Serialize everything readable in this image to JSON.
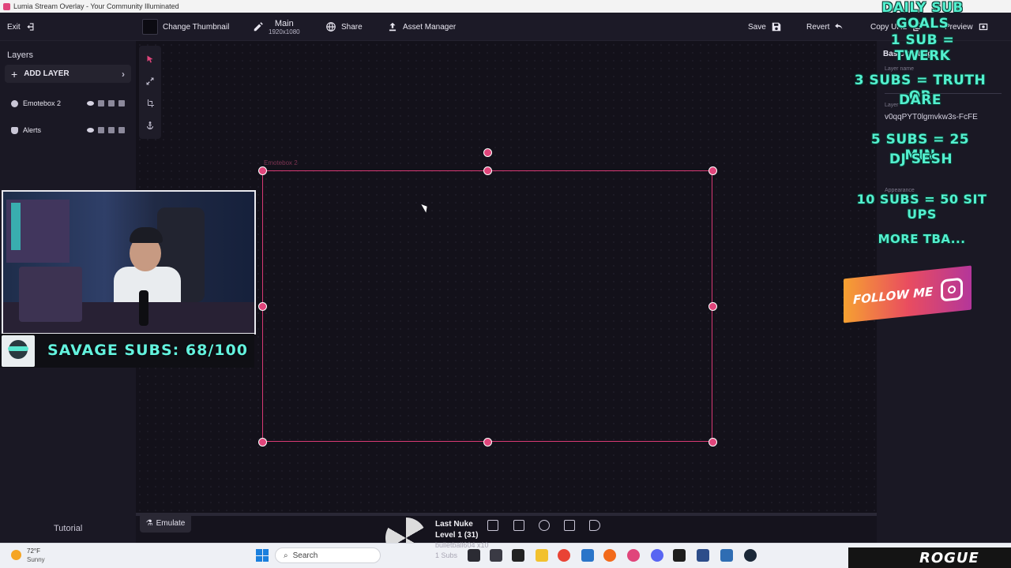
{
  "window": {
    "title": "Lumia Stream Overlay - Your Community Illuminated"
  },
  "toolbar": {
    "exit_label": "Exit",
    "change_thumbnail_label": "Change Thumbnail",
    "main_title": "Main",
    "main_resolution": "1920x1080",
    "share_label": "Share",
    "asset_manager_label": "Asset Manager",
    "save_label": "Save",
    "revert_label": "Revert",
    "copy_url_label": "Copy URL",
    "preview_label": "Preview"
  },
  "sidebar": {
    "layers_title": "Layers",
    "add_layer_label": "ADD LAYER",
    "layers": [
      {
        "name": "Emotebox 2",
        "icon": "emote-icon"
      },
      {
        "name": "Alerts",
        "icon": "bell-icon"
      }
    ],
    "tutorial_label": "Tutorial"
  },
  "canvas": {
    "selection_label": "Emotebox 2",
    "emulate_label": "Emulate"
  },
  "right_panel": {
    "basic_settings": "Basic settings",
    "layer_name_label": "Layer name",
    "layer_id_label": "Layer",
    "layer_id_value": "v0qqPYT0lgmvkw3s-FcFE",
    "appearance_label": "Appearance"
  },
  "overlay": {
    "subs_text": "SAVAGE SUBS: 68/100",
    "goals": [
      "DAILY SUB GOALS",
      "1 SUB = TWERK",
      "3 SUBS = TRUTH OR",
      "DARE",
      "5 SUBS = 25 MIN",
      "DJ SESH",
      "10 SUBS = 50 SIT UPS",
      "MORE TBA..."
    ],
    "follow_text": "FOLLOW ME",
    "last_nuke": "Last Nuke",
    "level": "Level 1  (31)",
    "nuke_hint1": "bulletball604 x10",
    "nuke_hint2": "1 Subs"
  },
  "taskbar": {
    "temperature": "72°F",
    "weather": "Sunny",
    "search_placeholder": "Search",
    "rogue_text": "ROGUE"
  },
  "colors": {
    "accent": "#e0457b",
    "panel": "#1a1824",
    "canvas": "#13111a",
    "goal_text": "#53f0cf"
  }
}
